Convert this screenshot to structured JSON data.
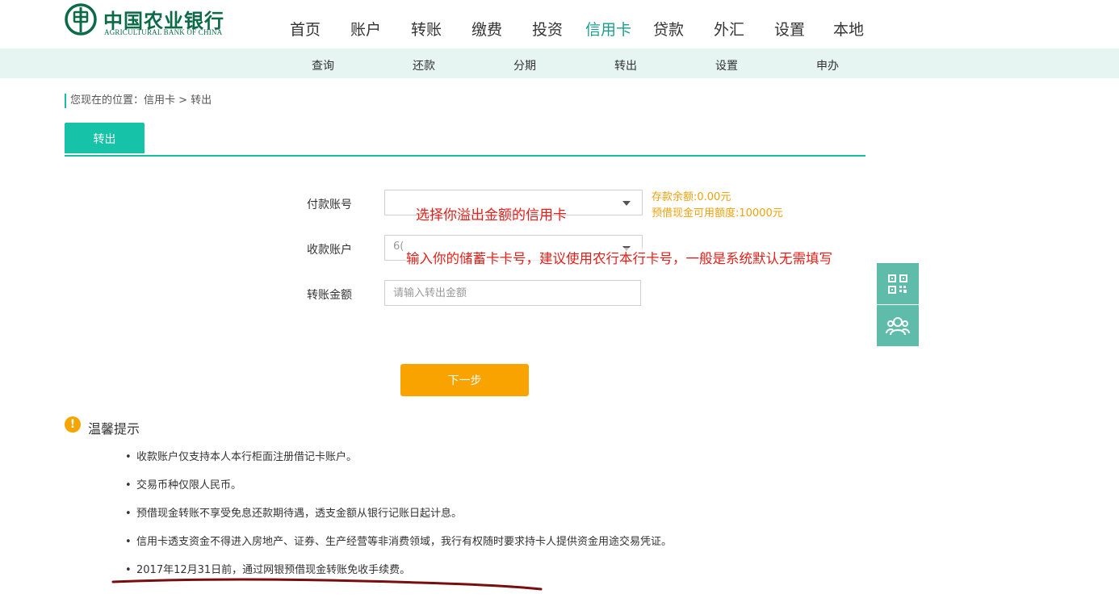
{
  "brand": {
    "name_cn": "中国农业银行",
    "name_en": "AGRICULTURAL BANK OF CHINA",
    "color": "#0b6b47"
  },
  "main_nav": [
    {
      "label": "首页",
      "active": false
    },
    {
      "label": "账户",
      "active": false
    },
    {
      "label": "转账",
      "active": false
    },
    {
      "label": "缴费",
      "active": false
    },
    {
      "label": "投资",
      "active": false
    },
    {
      "label": "信用卡",
      "active": true
    },
    {
      "label": "贷款",
      "active": false
    },
    {
      "label": "外汇",
      "active": false
    },
    {
      "label": "设置",
      "active": false
    },
    {
      "label": "本地",
      "active": false
    }
  ],
  "sub_nav": [
    "查询",
    "还款",
    "分期",
    "转出",
    "设置",
    "申办"
  ],
  "breadcrumb": "您现在的位置：信用卡 > 转出",
  "tab": {
    "label": "转出"
  },
  "form": {
    "payer_label": "付款账号",
    "payer_value": "",
    "payee_label": "收款账户",
    "payee_value": "6(",
    "amount_label": "转账金额",
    "amount_placeholder": "请输入转出金额",
    "balance_text": "存款余额:0.00元",
    "credit_text": "预借现金可用额度:10000元",
    "next_label": "下一步"
  },
  "annotations": {
    "payer_note": "选择你溢出金额的信用卡",
    "payee_note": "输入你的储蓄卡卡号，建议使用农行本行卡号，一般是系统默认无需填写",
    "color": "#e0201a"
  },
  "floating": {
    "qr_icon": "qr-code-icon",
    "service_icon": "customer-service-icon",
    "color": "#5fbcaa"
  },
  "tips": {
    "title": "温馨提示",
    "items": [
      "收款账户仅支持本人本行柜面注册借记卡账户。",
      "交易币种仅限人民币。",
      "预借现金转账不享受免息还款期待遇，透支金额从银行记账日起计息。",
      "信用卡透支资金不得进入房地产、证券、生产经营等非消费领域，我行有权随时要求持卡人提供资金用途交易凭证。",
      "2017年12月31日前，通过网银预借现金转账免收手续费。"
    ]
  },
  "theme": {
    "accent": "#16c3a8",
    "button": "#f8a300",
    "subnav_bg": "#e6f4f2"
  }
}
